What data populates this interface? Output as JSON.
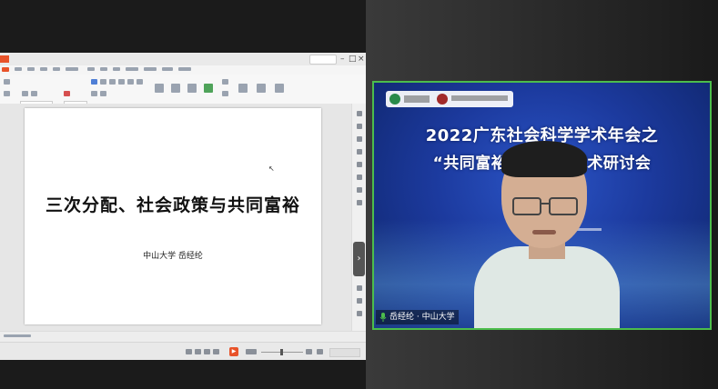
{
  "presentation": {
    "slide_title": "三次分配、社会政策与共同富裕",
    "slide_author": "中山大学   岳经纶"
  },
  "video": {
    "banner_line1": "2022广东社会科学学术年会之",
    "banner_line2": "“共同富裕       理论坛”学术研讨会",
    "participant_name": "岳经纶 · 中山大学",
    "border_color": "#4cbd4c"
  },
  "wps": {
    "accent_color": "#e8532a",
    "zoom_value": 0.45
  }
}
